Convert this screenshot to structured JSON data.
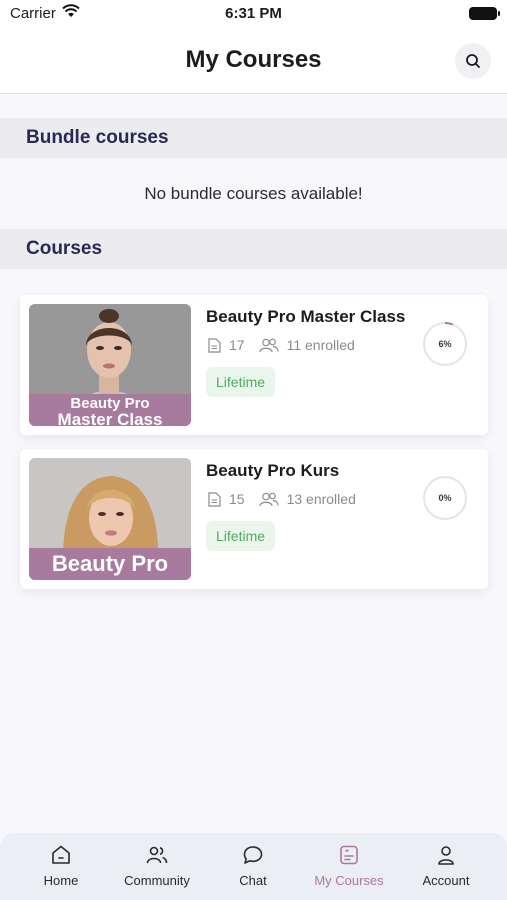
{
  "status_bar": {
    "carrier": "Carrier",
    "time": "6:31 PM"
  },
  "header": {
    "title": "My Courses",
    "search_icon": "search-icon"
  },
  "bundle_section": {
    "title": "Bundle courses",
    "empty_message": "No bundle courses available!"
  },
  "courses_section": {
    "title": "Courses",
    "items": [
      {
        "title": "Beauty Pro Master Class",
        "thumb_line1": "Beauty Pro",
        "thumb_line2": "Master Class",
        "lessons": "17",
        "enrolled": "11 enrolled",
        "access": "Lifetime",
        "progress_label": "6%",
        "progress": 0.06
      },
      {
        "title": "Beauty Pro Kurs",
        "thumb_line1": "Beauty Pro",
        "lessons": "15",
        "enrolled": "13 enrolled",
        "access": "Lifetime",
        "progress_label": "0%",
        "progress": 0
      }
    ]
  },
  "tabbar": {
    "items": [
      {
        "label": "Home",
        "icon": "home-icon"
      },
      {
        "label": "Community",
        "icon": "community-icon"
      },
      {
        "label": "Chat",
        "icon": "chat-icon"
      },
      {
        "label": "My Courses",
        "icon": "my-courses-icon"
      },
      {
        "label": "Account",
        "icon": "account-icon"
      }
    ],
    "active_index": 3
  },
  "colors": {
    "accent": "#a87a9d",
    "badge_green": "#4cae5d",
    "section_title": "#2a2955"
  }
}
